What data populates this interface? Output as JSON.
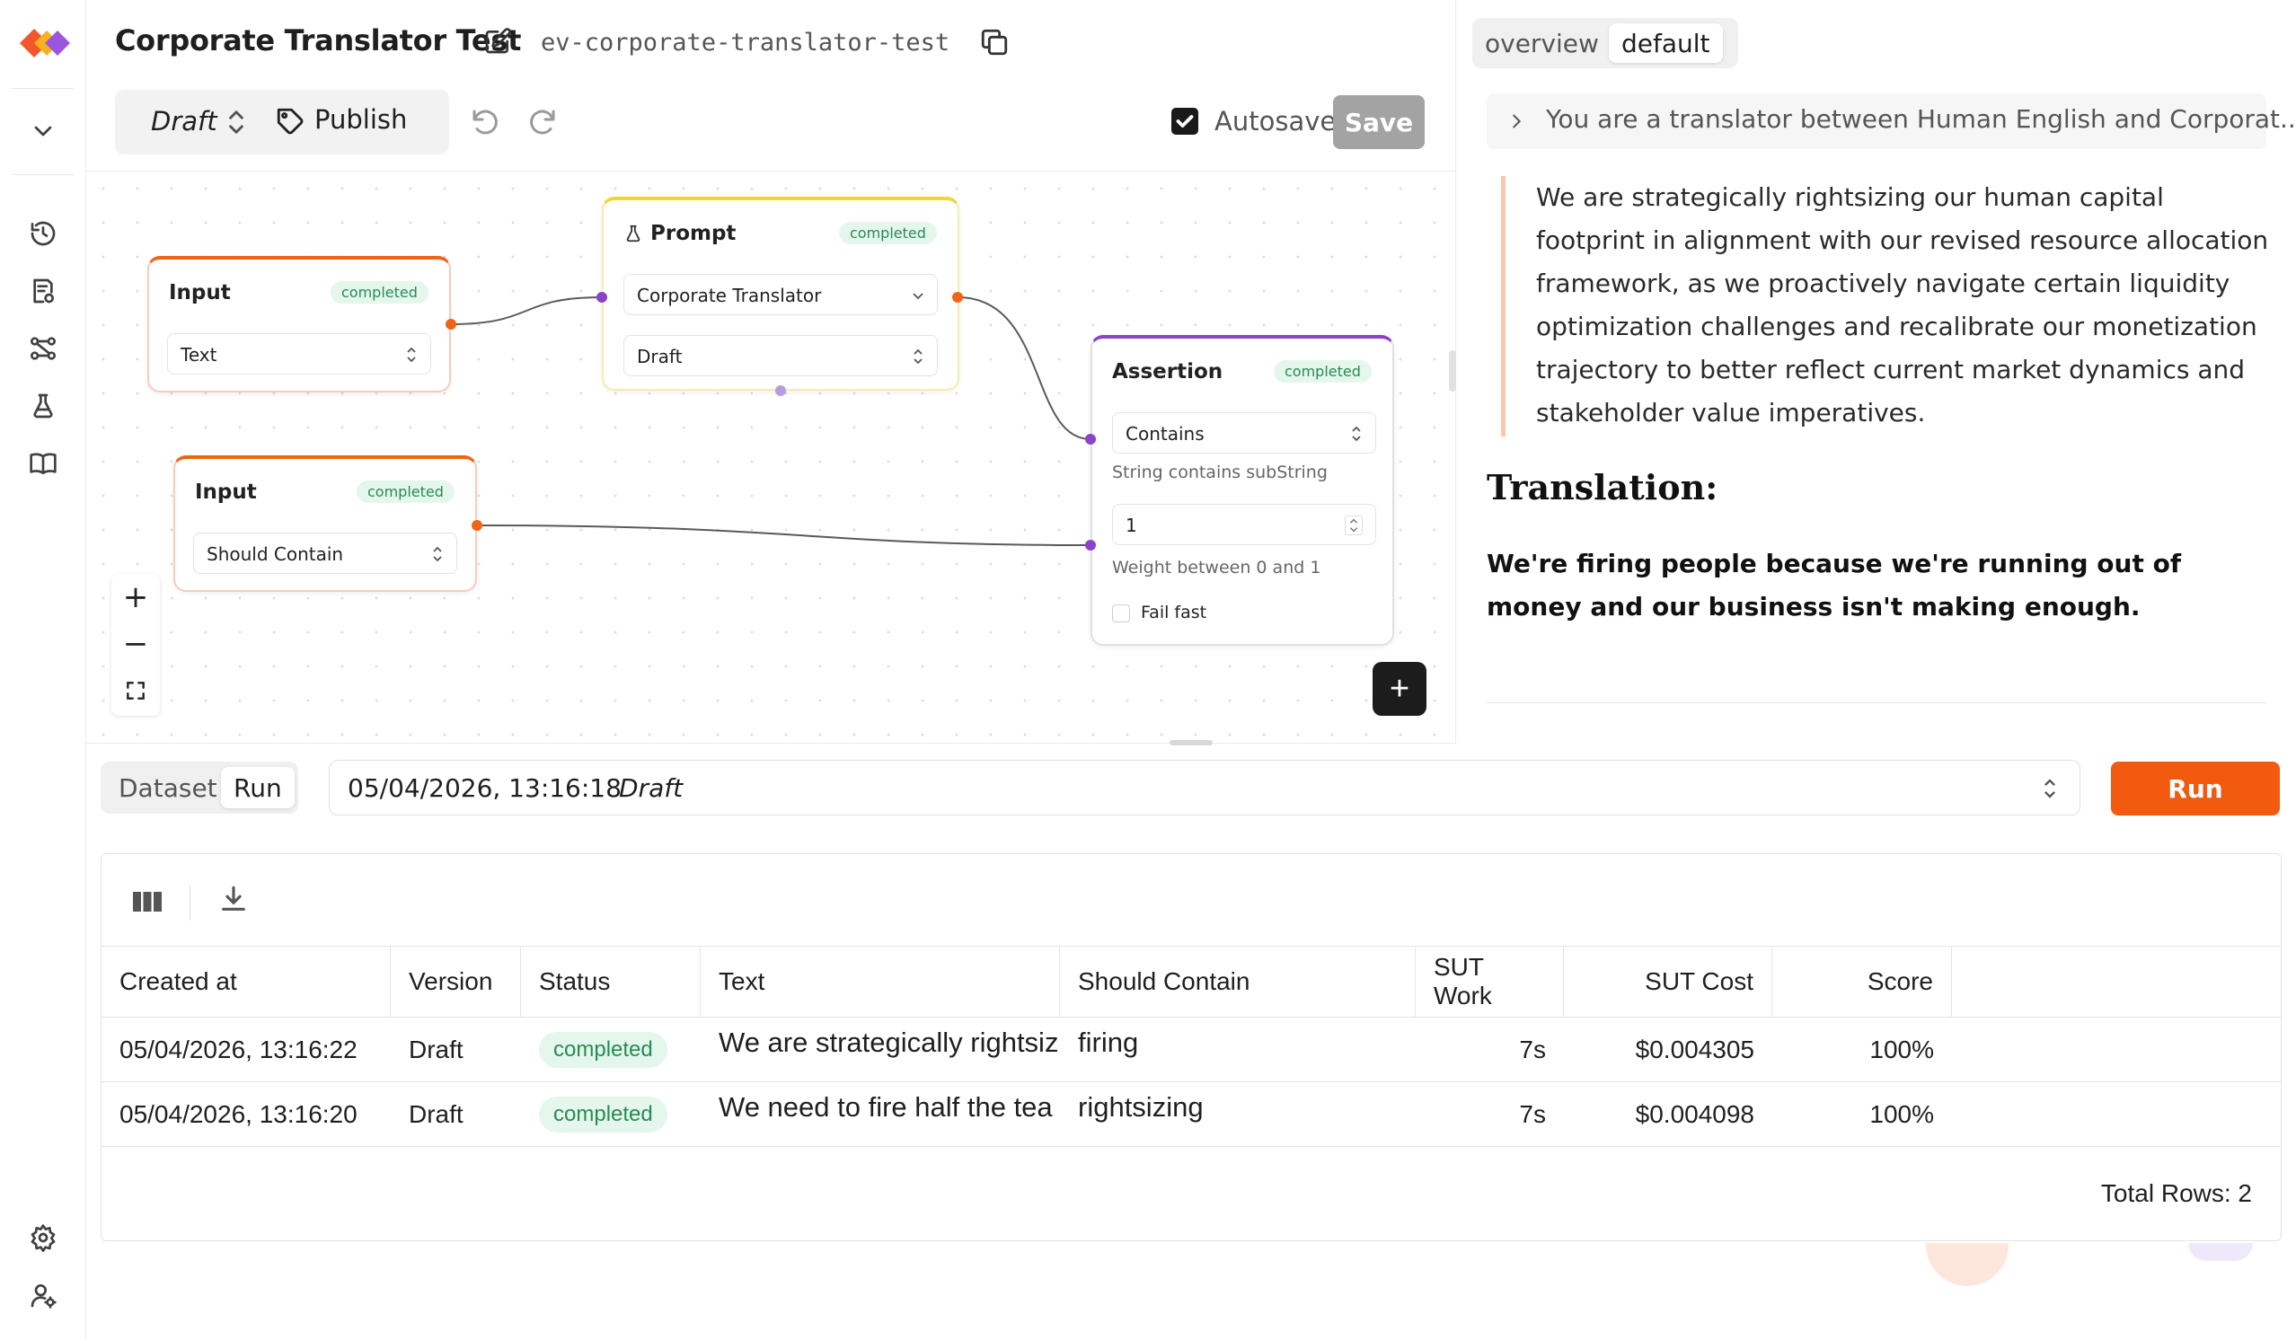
{
  "header": {
    "title": "Corporate Translator Test",
    "slug": "ev-corporate-translator-test",
    "version_select": "Draft",
    "publish_label": "Publish",
    "autosave_label": "Autosave",
    "save_label": "Save"
  },
  "canvas": {
    "nodes": {
      "input_text": {
        "title": "Input",
        "status": "completed",
        "field": "Text"
      },
      "prompt": {
        "title": "Prompt",
        "status": "completed",
        "prompt_select": "Corporate Translator",
        "version_select": "Draft"
      },
      "input_contains": {
        "title": "Input",
        "status": "completed",
        "field": "Should Contain"
      },
      "assertion": {
        "title": "Assertion",
        "status": "completed",
        "type_select": "Contains",
        "type_hint": "String contains subString",
        "weight_value": "1",
        "weight_hint": "Weight between 0 and 1",
        "fail_fast_label": "Fail fast"
      }
    },
    "zoom": {
      "in": "+",
      "out": "−"
    },
    "add_node": "+"
  },
  "right_panel": {
    "tabs": [
      "overview",
      "default"
    ],
    "active_tab": "default",
    "system_message": "You are a translator between Human English and Corporat...",
    "input_text": "We are strategically rightsizing our human capital footprint in alignment with our revised resource allocation framework, as we proactively navigate certain liquidity optimization challenges and recalibrate our monetization trajectory to better reflect current market dynamics and stakeholder value imperatives.",
    "translation_heading": "Translation:",
    "translation_text": "We're firing people because we're running out of money and our business isn't making enough."
  },
  "bottom": {
    "tabs": [
      "Dataset",
      "Run"
    ],
    "active_tab": "Run",
    "run_select": {
      "date": "05/04/2026, 13:16:18",
      "version": "Draft"
    },
    "run_button": "Run",
    "table": {
      "columns": [
        "Created at",
        "Version",
        "Status",
        "Text",
        "Should Contain",
        "SUT Work",
        "SUT Cost",
        "Score"
      ],
      "rows": [
        {
          "created_at": "05/04/2026, 13:16:22",
          "version": "Draft",
          "status": "completed",
          "text": "We are strategically rightsiz",
          "should_contain": "firing",
          "sut_work": "7s",
          "sut_cost": "$0.004305",
          "score": "100%"
        },
        {
          "created_at": "05/04/2026, 13:16:20",
          "version": "Draft",
          "status": "completed",
          "text": "We need to fire half the tea",
          "should_contain": "rightsizing",
          "sut_work": "7s",
          "sut_cost": "$0.004098",
          "score": "100%"
        }
      ],
      "total_rows": "Total Rows: 2"
    }
  },
  "colors": {
    "accent_orange": "#f25a0f",
    "node_orange": "#f06418",
    "node_yellow": "#f2d630",
    "node_purple": "#8a43c9",
    "status_green": "#268c55"
  }
}
